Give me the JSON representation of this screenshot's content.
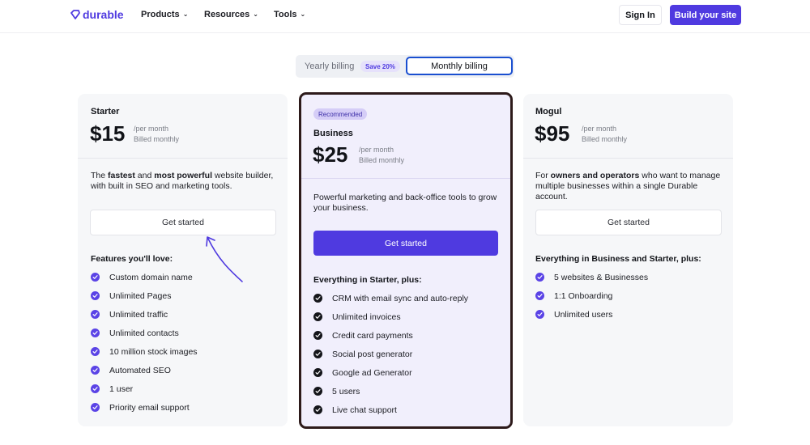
{
  "header": {
    "logo_text": "durable",
    "nav": [
      {
        "label": "Products"
      },
      {
        "label": "Resources"
      },
      {
        "label": "Tools"
      }
    ],
    "sign_in": "Sign In",
    "cta": "Build your site"
  },
  "billing": {
    "yearly_label": "Yearly billing",
    "save_badge": "Save 20%",
    "monthly_label": "Monthly billing",
    "selected": "monthly"
  },
  "plans": [
    {
      "name": "Starter",
      "price": "$15",
      "per": "/per month",
      "billed": "Billed monthly",
      "desc_parts": [
        "The ",
        "fastest",
        " and ",
        "most powerful",
        " website builder, with built in SEO and marketing tools."
      ],
      "button": "Get started",
      "features_heading": "Features you'll love:",
      "features": [
        "Custom domain name",
        "Unlimited Pages",
        "Unlimited traffic",
        "Unlimited contacts",
        "10 million stock images",
        "Automated SEO",
        "1 user",
        "Priority email support"
      ]
    },
    {
      "badge": "Recommended",
      "name": "Business",
      "price": "$25",
      "per": "/per month",
      "billed": "Billed monthly",
      "desc": "Powerful marketing and back-office tools to grow your business.",
      "button": "Get started",
      "features_heading": "Everything in Starter, plus:",
      "features": [
        "CRM with email sync and auto-reply",
        "Unlimited invoices",
        "Credit card payments",
        "Social post generator",
        "Google ad Generator",
        "5 users",
        "Live chat support"
      ]
    },
    {
      "name": "Mogul",
      "price": "$95",
      "per": "/per month",
      "billed": "Billed monthly",
      "desc_parts": [
        "For ",
        "owners and operators",
        " who want to manage multiple businesses within a single Durable account."
      ],
      "button": "Get started",
      "features_heading": "Everything in Business and Starter, plus:",
      "features": [
        "5 websites & Businesses",
        "1:1 Onboarding",
        "Unlimited users"
      ]
    }
  ],
  "colors": {
    "brand": "#4f3ae0",
    "recommended_border": "#2d1a1a"
  }
}
